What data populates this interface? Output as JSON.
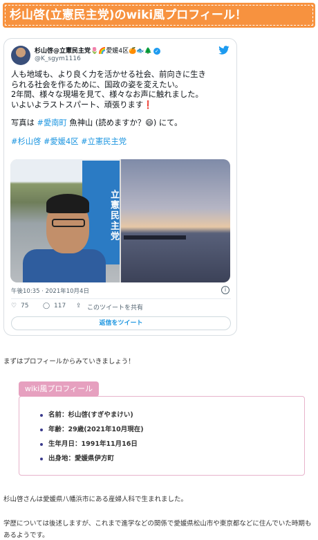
{
  "header": {
    "title": "杉山啓(立憲民主党)のwiki風プロフィール！"
  },
  "tweet": {
    "name": "杉山啓@立憲民主党",
    "name_emoji": "🌷🌈愛媛4区🍊🐟🌲",
    "handle": "@K_sgym1116",
    "body_lines": [
      "人も地域も、より良く力を活かせる社会、前向きに生き",
      "られる社会を作るために、国政の姿を変えたい。",
      "2年間、様々な現場を見て、様々なお声に触れました。",
      "いよいよラストスパート、頑張ります"
    ],
    "heart_emoji": "❗",
    "photo_prefix": "写真は ",
    "photo_link": "#愛南町",
    "photo_suffix": " 魚神山 (読めますか？😄) にて。",
    "hashtags": [
      "#杉山啓",
      "#愛媛4区",
      "#立憲民主党"
    ],
    "banner_text": "立憲民主党",
    "timestamp": "午後10:35 · 2021年10月4日",
    "likes": "75",
    "replies": "117",
    "share_label": "このツイートを共有",
    "reply_button": "返信をツイート"
  },
  "intro_text": "まずはプロフィールからみていきましょう！",
  "profile": {
    "label": "wiki風プロフィール",
    "items": [
      "名前：杉山啓(すぎやまけい)",
      "年齢：29歳(2021年10月現在)",
      "生年月日：1991年11月16日",
      "出身地：愛媛県伊方町"
    ]
  },
  "para_birth": "杉山啓さんは愛媛県八幡浜市にある産婦人科で生まれました。",
  "para_edu": "学歴については後述しますが、これまで進学などの関係で愛媛県松山市や東京都などに住んでいた時期もあるようです。",
  "colors": {
    "accent": "#f7923f",
    "pink": "#e6a0bf",
    "twitter": "#1d9bf0"
  }
}
